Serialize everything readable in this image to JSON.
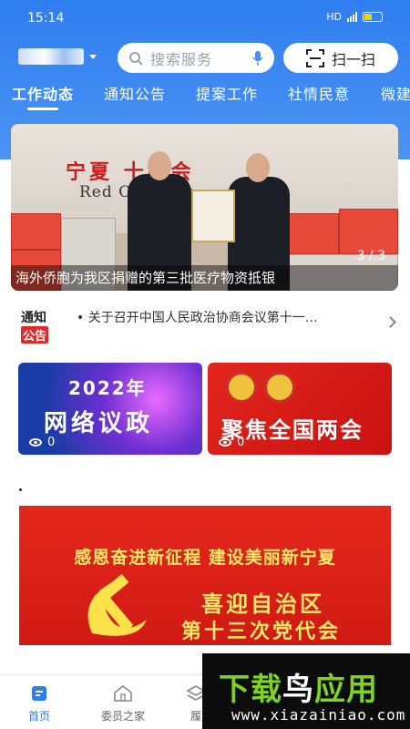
{
  "status_bar": {
    "time": "15:14",
    "network": "HD",
    "battery_level": 0.35
  },
  "header": {
    "search_placeholder": "搜索服务",
    "scan_label": "扫一扫",
    "accent": "#2f7ef0"
  },
  "tabs": [
    {
      "label": "工作动态",
      "active": true
    },
    {
      "label": "通知公告",
      "active": false
    },
    {
      "label": "提案工作",
      "active": false
    },
    {
      "label": "社情民意",
      "active": false
    },
    {
      "label": "微建",
      "active": false
    }
  ],
  "banner": {
    "caption": "海外侨胞为我区捐赠的第三批医疗物资抵银",
    "page_indicator": "3 / 3",
    "scene_text_cn": "宁夏  十字会",
    "scene_text_en": "Red C         of N    ia"
  },
  "notice": {
    "logo_top": "通知",
    "logo_bottom": "公告",
    "text": "• 关于召开中国人民政治协商会议第十一…"
  },
  "cards": [
    {
      "year": "2022年",
      "title": "网络议政",
      "views": "0"
    },
    {
      "title": "聚焦全国两会",
      "views": "0"
    }
  ],
  "poster": {
    "line1": "感恩奋进新征程  建设美丽新宁夏",
    "line2": "喜迎自治区",
    "line3": "第十三次党代会"
  },
  "bottom_nav": [
    {
      "label": "首页",
      "icon": "home-icon",
      "active": true
    },
    {
      "label": "委员之家",
      "icon": "house-icon",
      "active": false
    },
    {
      "label": "履",
      "icon": "layers-icon",
      "active": false
    }
  ],
  "watermark": {
    "title_green": "下载",
    "title_white": "鸟",
    "title_green2": "应用",
    "url": "www.xiazainiao.com"
  }
}
